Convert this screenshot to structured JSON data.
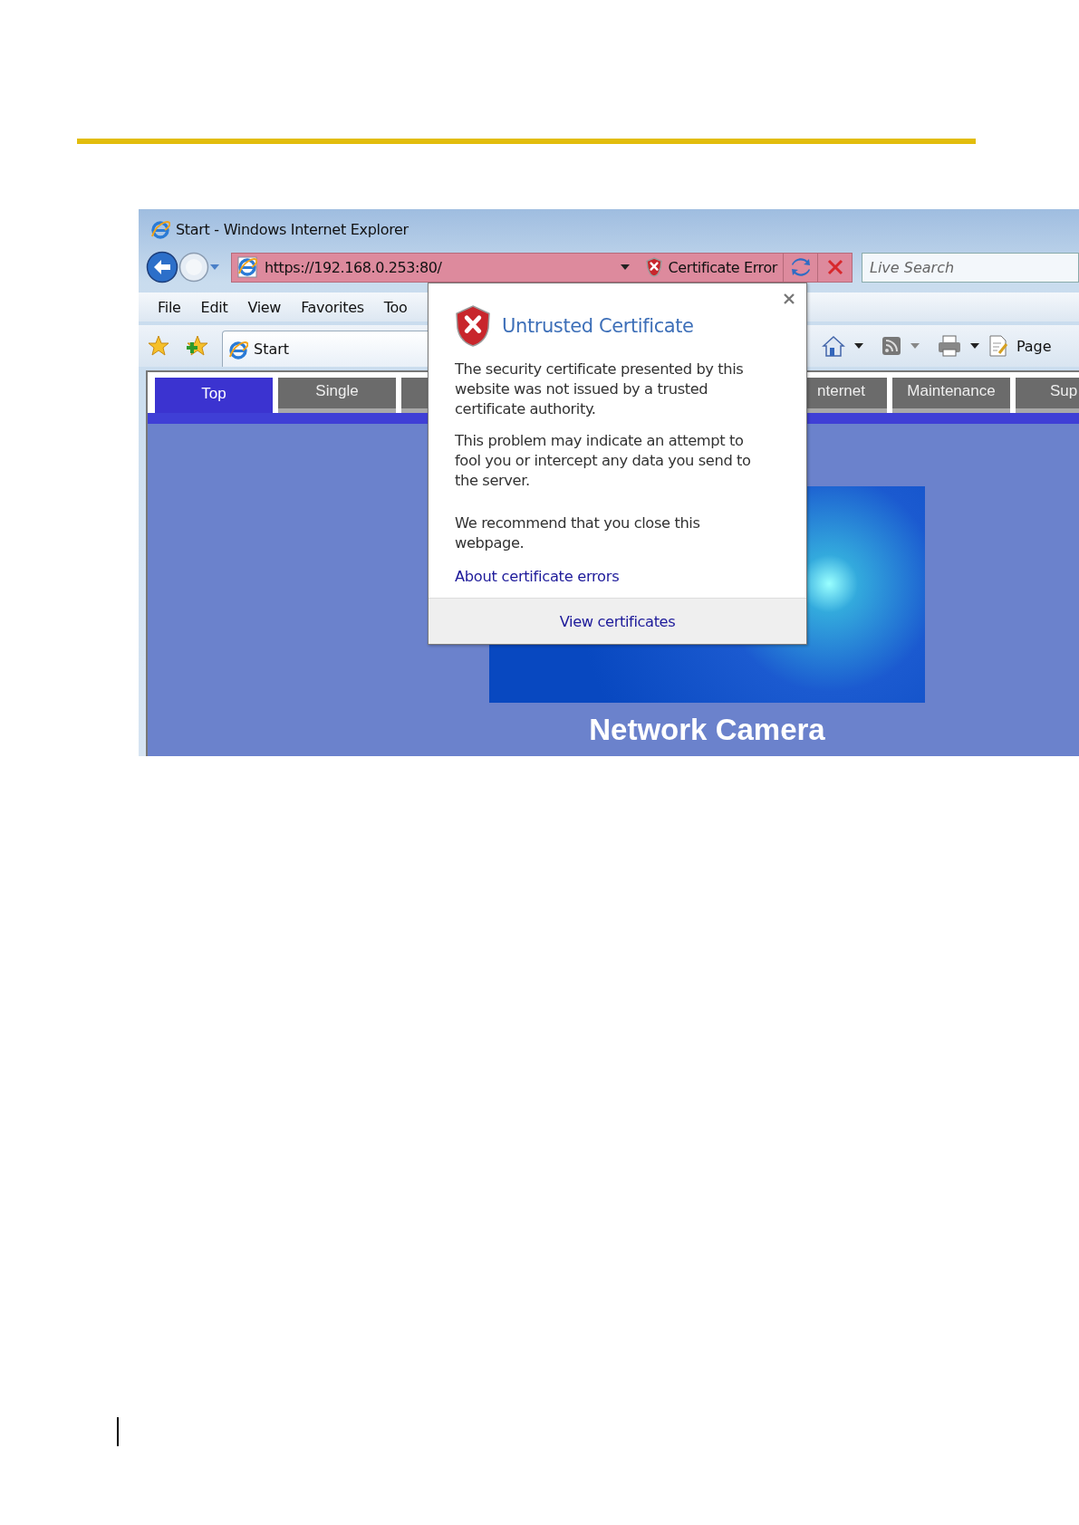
{
  "window": {
    "title": "Start - Windows Internet Explorer"
  },
  "address_bar": {
    "url": "https://192.168.0.253:80/",
    "certificate_error": "Certificate Error"
  },
  "search": {
    "placeholder": "Live Search"
  },
  "menu": [
    "File",
    "Edit",
    "View",
    "Favorites",
    "Too"
  ],
  "favorites_bar": {
    "tab": "Start"
  },
  "command_bar": {
    "page": "Page"
  },
  "page_tabs": [
    {
      "label": "Top",
      "selected": true
    },
    {
      "label": "Single",
      "selected": false
    },
    {
      "label": "nternet",
      "selected": false
    },
    {
      "label": "Maintenance",
      "selected": false
    },
    {
      "label": "Sup",
      "selected": false
    }
  ],
  "banner": {
    "title": "Network Camera"
  },
  "dialog": {
    "title": "Untrusted Certificate",
    "paragraphs": [
      "The security certificate presented by this website was not issued by a trusted certificate authority.",
      "This problem may indicate an attempt to fool you or intercept any data you send to the server.",
      "We recommend that you close this webpage."
    ],
    "link": "About certificate errors",
    "button": "View certificates"
  }
}
